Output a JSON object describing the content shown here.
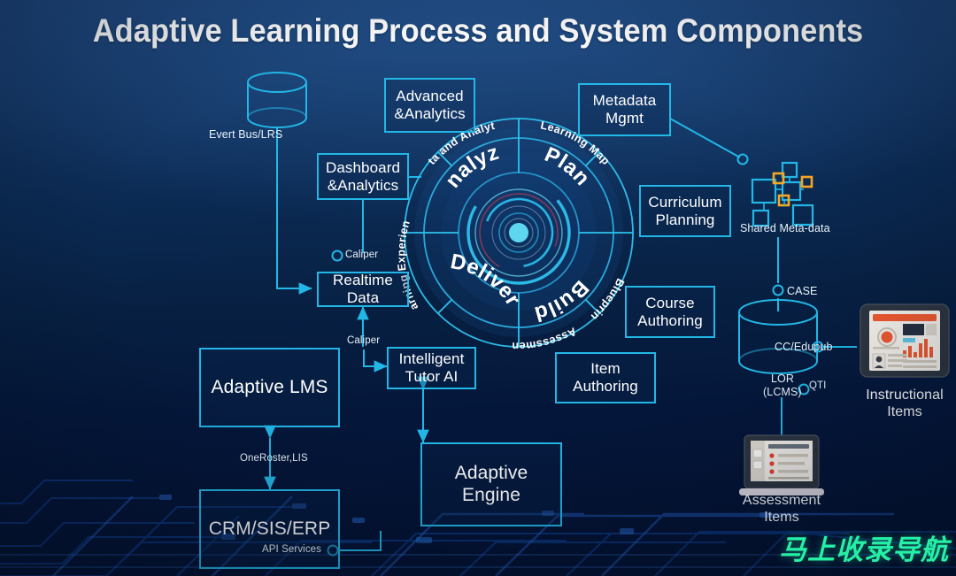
{
  "title": "Adaptive Learning Process and System Components",
  "colors": {
    "accent_cyan": "#22b7e6",
    "bright_cyan": "#3fd2f5",
    "background_top": "#1d4378",
    "background_bottom": "#031130",
    "orange": "#f5a623",
    "watermark_green": "#25f0a6",
    "text_white": "#ffffff"
  },
  "hub": {
    "phases": [
      {
        "name": "Analyze",
        "position": "top-left"
      },
      {
        "name": "Plan",
        "position": "top-right"
      },
      {
        "name": "Build",
        "position": "bottom-right"
      },
      {
        "name": "Deliver",
        "position": "bottom-left"
      }
    ],
    "outer_labels": [
      {
        "name": "Data and Analytics",
        "position": "upper-left"
      },
      {
        "name": "Learning Map",
        "position": "upper-right"
      },
      {
        "name": "Blueprint",
        "position": "lower-right"
      },
      {
        "name": "Assessment",
        "position": "bottom-right"
      },
      {
        "name": "Learning Experience",
        "position": "lower-left"
      }
    ]
  },
  "boxes": {
    "advanced_analytics": "Advanced\n&Analytics",
    "advanced_analytics_l1": "Advanced",
    "advanced_analytics_l2": "&Analytics",
    "metadata_mgmt_l1": "Metadata",
    "metadata_mgmt_l2": "Mgmt",
    "dashboard_l1": "Dashboard",
    "dashboard_l2": "&Analytics",
    "realtime_data": "Realtime Data",
    "curriculum_l1": "Curriculum",
    "curriculum_l2": "Planning",
    "course_authoring_l1": "Course",
    "course_authoring_l2": "Authoring",
    "item_authoring_l1": "Item",
    "item_authoring_l2": "Authoring",
    "intelligent_tutor_l1": "Intelligent",
    "intelligent_tutor_l2": "Tutor AI",
    "adaptive_lms": "Adaptive LMS",
    "adaptive_engine_l1": "Adaptive",
    "adaptive_engine_l2": "Engine",
    "crm_sis_erp": "CRM/SIS/ERP"
  },
  "captions": {
    "event_bus": "Evert Bus/LRS",
    "caliper_dashboard": "Caliper",
    "caliper_tutor": "Caliper",
    "oneroster_lis": "OneRoster,LIS",
    "api_services": "API Services",
    "shared_metadata": "Shared Meta-data",
    "case": "CASE",
    "cc_edupub": "CC/Edupub",
    "lor_l1": "LOR",
    "lor_l2": "(LCMS)",
    "qti": "QTI"
  },
  "icon_labels": {
    "instructional_items_l1": "Instructional",
    "instructional_items_l2": "Items",
    "assessment_items_l1": "Assessment",
    "assessment_items_l2": "Items"
  },
  "icons": {
    "event_bus": "database-cylinder-icon",
    "lor": "database-cylinder-icon",
    "shared_metadata": "node-graph-icon",
    "instructional_items": "tablet-dashboard-icon",
    "assessment_items": "laptop-checklist-icon"
  },
  "watermark": "马上收录导航"
}
